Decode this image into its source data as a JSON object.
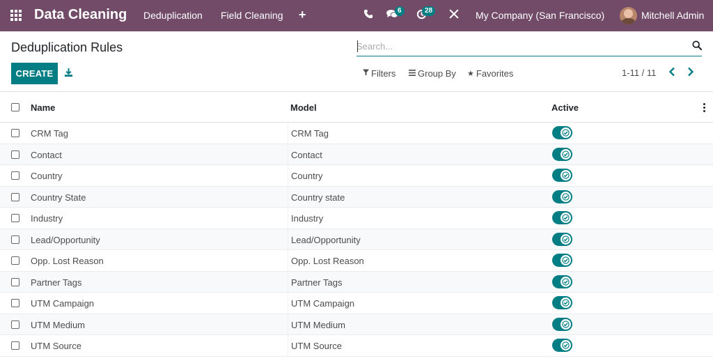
{
  "navbar": {
    "brand": "Data Cleaning",
    "menu": [
      "Deduplication",
      "Field Cleaning"
    ],
    "chat_badge": "6",
    "activity_badge": "28",
    "company": "My Company (San Francisco)",
    "user": "Mitchell Admin"
  },
  "control": {
    "title": "Deduplication Rules",
    "search_placeholder": "Search...",
    "create_label": "CREATE",
    "filters_label": "Filters",
    "groupby_label": "Group By",
    "favorites_label": "Favorites",
    "pager": "1-11 / 11"
  },
  "table": {
    "headers": {
      "name": "Name",
      "model": "Model",
      "active": "Active"
    },
    "rows": [
      {
        "name": "CRM Tag",
        "model": "CRM Tag",
        "active": true
      },
      {
        "name": "Contact",
        "model": "Contact",
        "active": true
      },
      {
        "name": "Country",
        "model": "Country",
        "active": true
      },
      {
        "name": "Country State",
        "model": "Country state",
        "active": true
      },
      {
        "name": "Industry",
        "model": "Industry",
        "active": true
      },
      {
        "name": "Lead/Opportunity",
        "model": "Lead/Opportunity",
        "active": true
      },
      {
        "name": "Opp. Lost Reason",
        "model": "Opp. Lost Reason",
        "active": true
      },
      {
        "name": "Partner Tags",
        "model": "Partner Tags",
        "active": true
      },
      {
        "name": "UTM Campaign",
        "model": "UTM Campaign",
        "active": true
      },
      {
        "name": "UTM Medium",
        "model": "UTM Medium",
        "active": true
      },
      {
        "name": "UTM Source",
        "model": "UTM Source",
        "active": true
      }
    ]
  },
  "colors": {
    "navbar": "#714b67",
    "accent": "#017e84"
  },
  "icons": [
    "apps-icon",
    "phone-icon",
    "chat-icon",
    "activity-icon",
    "tools-icon",
    "search-icon",
    "download-icon",
    "filter-icon",
    "groupby-icon",
    "star-icon",
    "chevron-left-icon",
    "chevron-right-icon",
    "check-icon",
    "kebab-icon"
  ]
}
